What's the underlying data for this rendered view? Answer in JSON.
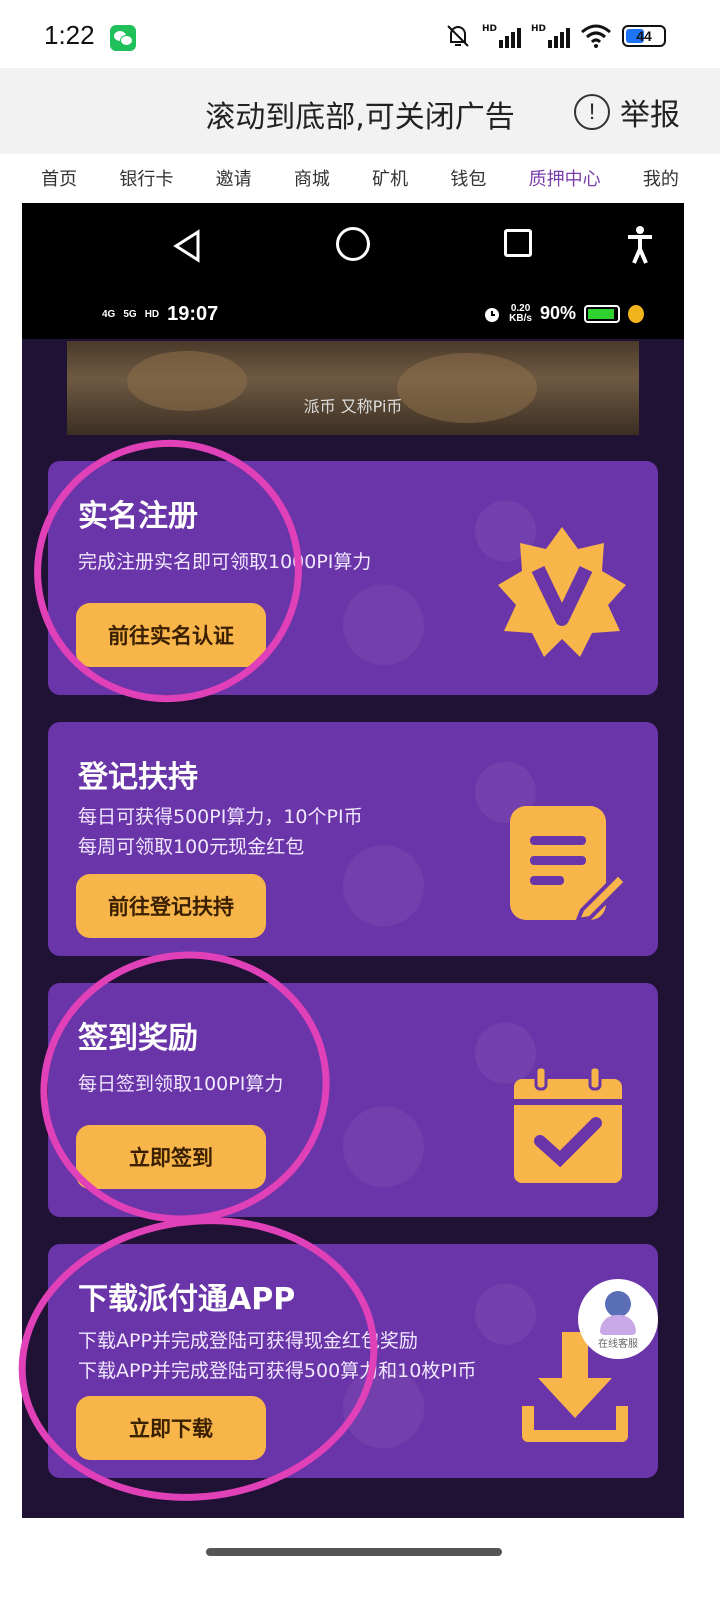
{
  "status_bar": {
    "time": "1:22",
    "battery": "44",
    "hd1": "HD",
    "hd2": "HD"
  },
  "ad_bar": {
    "text": "滚动到底部,可关闭广告",
    "report_label": "举报",
    "report_icon": "!"
  },
  "top_nav": {
    "items": [
      "首页",
      "银行卡",
      "邀请",
      "商城",
      "矿机",
      "钱包",
      "质押中心",
      "我的"
    ],
    "active_index": 6
  },
  "inner_status": {
    "time": "19:07",
    "net1": "4G",
    "net2": "5G",
    "hd": "HD",
    "speed_top": "0.20",
    "speed_bottom": "KB/s",
    "battery": "90%"
  },
  "video": {
    "caption": "派币 又称Pi币"
  },
  "cards": [
    {
      "title": "实名注册",
      "desc": [
        "完成注册实名即可领取1000PI算力"
      ],
      "button": "前往实名认证",
      "icon": "verified-v-badge-icon"
    },
    {
      "title": "登记扶持",
      "desc": [
        "每日可获得500PI算力，10个PI币",
        "每周可领取100元现金红包"
      ],
      "button": "前往登记扶持",
      "icon": "document-edit-icon"
    },
    {
      "title": "签到奖励",
      "desc": [
        "每日签到领取100PI算力"
      ],
      "button": "立即签到",
      "icon": "calendar-check-icon"
    },
    {
      "title": "下载派付通APP",
      "desc": [
        "下载APP并完成登陆可获得现金红包奖励",
        "下载APP并完成登陆可获得500算力和10枚PI币"
      ],
      "button": "立即下载",
      "icon": "download-icon"
    }
  ],
  "customer_service": {
    "label": "在线客服"
  },
  "colors": {
    "card_bg": "#6a35a8",
    "button_bg": "#f8b64a",
    "highlight_circle": "#e040b8",
    "page_bg": "#201235"
  }
}
